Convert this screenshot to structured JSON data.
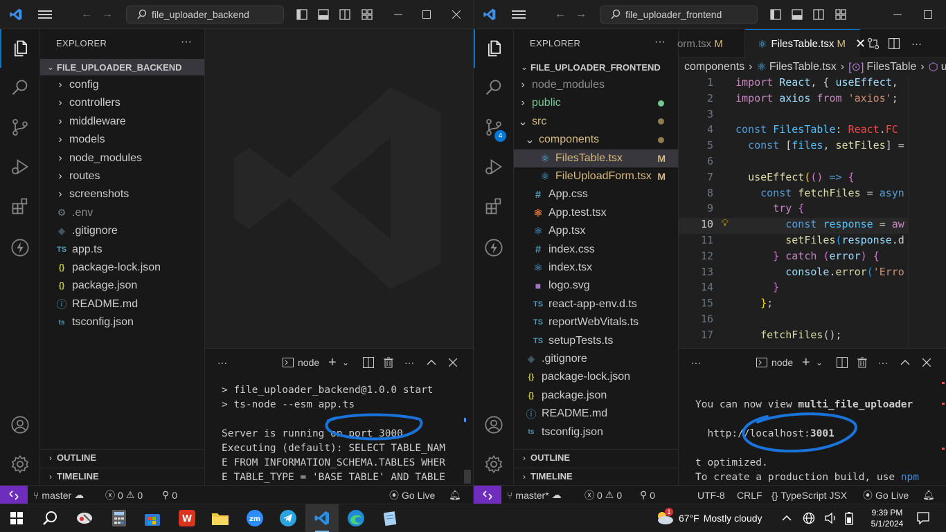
{
  "left": {
    "search": "file_uploader_backend",
    "explorer_title": "EXPLORER",
    "root_folder": "FILE_UPLOADER_BACKEND",
    "tree": [
      {
        "type": "folder",
        "label": "config"
      },
      {
        "type": "folder",
        "label": "controllers"
      },
      {
        "type": "folder",
        "label": "middleware"
      },
      {
        "type": "folder",
        "label": "models"
      },
      {
        "type": "folder",
        "label": "node_modules"
      },
      {
        "type": "folder",
        "label": "routes"
      },
      {
        "type": "folder",
        "label": "screenshots"
      },
      {
        "type": "env",
        "label": ".env"
      },
      {
        "type": "git",
        "label": ".gitignore"
      },
      {
        "type": "ts",
        "label": "app.ts",
        "icon_text": "TS"
      },
      {
        "type": "json",
        "label": "package-lock.json",
        "icon_text": "{}"
      },
      {
        "type": "json",
        "label": "package.json",
        "icon_text": "{}"
      },
      {
        "type": "info",
        "label": "README.md"
      },
      {
        "type": "tsconfig",
        "label": "tsconfig.json"
      }
    ],
    "outline": "OUTLINE",
    "timeline": "TIMELINE",
    "panel_tab": "node",
    "terminal": [
      "> file_uploader_backend@1.0.0 start",
      "> ts-node --esm app.ts",
      "",
      "Server is running on port 3000",
      "Executing (default): SELECT TABLE_NAM",
      "E FROM INFORMATION_SCHEMA.TABLES WHER",
      "E TABLE_TYPE = 'BASE TABLE' AND TABLE"
    ],
    "status": {
      "branch": "master",
      "errors": "0",
      "warnings": "0",
      "ports": "0",
      "golive": "Go Live"
    }
  },
  "right": {
    "search": "file_uploader_frontend",
    "explorer_title": "EXPLORER",
    "root_folder": "FILE_UPLOADER_FRONTEND",
    "scm_badge": "4",
    "tree": [
      {
        "type": "folder",
        "label": "node_modules",
        "indent": 1,
        "color": "#8b8b8b"
      },
      {
        "type": "folder",
        "label": "public",
        "indent": 1,
        "color": "#73c991",
        "dot": "#73c991"
      },
      {
        "type": "folder-open",
        "label": "src",
        "indent": 1,
        "color": "#d7ba7d",
        "dot": "#8e7d4f"
      },
      {
        "type": "folder-open",
        "label": "components",
        "indent": 2,
        "color": "#d7ba7d",
        "dot": "#8e7d4f"
      },
      {
        "type": "react",
        "label": "FilesTable.tsx",
        "indent": 3,
        "color": "#d7ba7d",
        "status": "M",
        "selected": true
      },
      {
        "type": "react",
        "label": "FileUploadForm.tsx",
        "indent": 3,
        "color": "#d7ba7d",
        "status": "M"
      },
      {
        "type": "css",
        "label": "App.css",
        "indent": 2,
        "icon_text": "#"
      },
      {
        "type": "test",
        "label": "App.test.tsx",
        "indent": 2
      },
      {
        "type": "react",
        "label": "App.tsx",
        "indent": 2
      },
      {
        "type": "css",
        "label": "index.css",
        "indent": 2,
        "icon_text": "#"
      },
      {
        "type": "react",
        "label": "index.tsx",
        "indent": 2
      },
      {
        "type": "svg",
        "label": "logo.svg",
        "indent": 2
      },
      {
        "type": "ts",
        "label": "react-app-env.d.ts",
        "indent": 2,
        "icon_text": "TS"
      },
      {
        "type": "ts",
        "label": "reportWebVitals.ts",
        "indent": 2,
        "icon_text": "TS"
      },
      {
        "type": "ts",
        "label": "setupTests.ts",
        "indent": 2,
        "icon_text": "TS"
      },
      {
        "type": "git",
        "label": ".gitignore",
        "indent": 1
      },
      {
        "type": "json",
        "label": "package-lock.json",
        "indent": 1,
        "icon_text": "{}"
      },
      {
        "type": "json",
        "label": "package.json",
        "indent": 1,
        "icon_text": "{}"
      },
      {
        "type": "info",
        "label": "README.md",
        "indent": 1
      },
      {
        "type": "tsconfig",
        "label": "tsconfig.json",
        "indent": 1
      }
    ],
    "outline": "OUTLINE",
    "timeline": "TIMELINE",
    "tabs": [
      {
        "label": "orm.tsx",
        "status": "M"
      },
      {
        "label": "FilesTable.tsx",
        "status": "M",
        "active": true
      }
    ],
    "breadcrumb": [
      "components",
      "FilesTable.tsx",
      "FilesTable",
      "u"
    ],
    "code": [
      {
        "n": "1",
        "tokens": [
          [
            "import ",
            "#c586c0"
          ],
          [
            "React",
            "#9cdcfe"
          ],
          [
            ", { ",
            "#cccccc"
          ],
          [
            "useEffect",
            "#9cdcfe"
          ],
          [
            ", ",
            "#cccccc"
          ]
        ]
      },
      {
        "n": "2",
        "tokens": [
          [
            "import ",
            "#c586c0"
          ],
          [
            "axios ",
            "#9cdcfe"
          ],
          [
            "from ",
            "#c586c0"
          ],
          [
            "'axios'",
            "#ce9178"
          ],
          [
            ";",
            "#cccccc"
          ]
        ]
      },
      {
        "n": "3",
        "tokens": []
      },
      {
        "n": "4",
        "tokens": [
          [
            "const ",
            "#569cd6"
          ],
          [
            "FilesTable",
            "#4fc1ff"
          ],
          [
            ": ",
            "#cccccc"
          ],
          [
            "React",
            "#f44747"
          ],
          [
            ".",
            "#cccccc"
          ],
          [
            "FC",
            "#f44747"
          ]
        ]
      },
      {
        "n": "5",
        "tokens": [
          [
            "  const ",
            "#569cd6"
          ],
          [
            "[",
            "#cccccc"
          ],
          [
            "files",
            "#4fc1ff"
          ],
          [
            ", ",
            "#cccccc"
          ],
          [
            "setFiles",
            "#dcdcaa"
          ],
          [
            "] =",
            "#cccccc"
          ]
        ]
      },
      {
        "n": "6",
        "tokens": []
      },
      {
        "n": "7",
        "tokens": [
          [
            "  ",
            "#cccccc"
          ],
          [
            "useEffect",
            "#dcdcaa"
          ],
          [
            "(",
            "#ffd700"
          ],
          [
            "() ",
            "#da70d6"
          ],
          [
            "=> ",
            "#569cd6"
          ],
          [
            "{",
            "#da70d6"
          ]
        ]
      },
      {
        "n": "8",
        "tokens": [
          [
            "    const ",
            "#569cd6"
          ],
          [
            "fetchFiles",
            "#dcdcaa"
          ],
          [
            " = ",
            "#cccccc"
          ],
          [
            "asyn",
            "#569cd6"
          ]
        ]
      },
      {
        "n": "9",
        "tokens": [
          [
            "      ",
            "#cccccc"
          ],
          [
            "try ",
            "#c586c0"
          ],
          [
            "{",
            "#da70d6"
          ]
        ]
      },
      {
        "n": "10",
        "tokens": [
          [
            "        const ",
            "#569cd6"
          ],
          [
            "response",
            "#4fc1ff"
          ],
          [
            " = ",
            "#cccccc"
          ],
          [
            "aw",
            "#c586c0"
          ]
        ],
        "current": true
      },
      {
        "n": "11",
        "tokens": [
          [
            "        ",
            "#cccccc"
          ],
          [
            "setFiles",
            "#dcdcaa"
          ],
          [
            "(",
            "#179fff"
          ],
          [
            "response",
            "#9cdcfe"
          ],
          [
            ".d",
            "#cccccc"
          ]
        ]
      },
      {
        "n": "12",
        "tokens": [
          [
            "      } ",
            "#da70d6"
          ],
          [
            "catch ",
            "#c586c0"
          ],
          [
            "(",
            "#da70d6"
          ],
          [
            "error",
            "#9cdcfe"
          ],
          [
            ") ",
            "#da70d6"
          ],
          [
            "{",
            "#da70d6"
          ]
        ]
      },
      {
        "n": "13",
        "tokens": [
          [
            "        ",
            "#cccccc"
          ],
          [
            "console",
            "#9cdcfe"
          ],
          [
            ".",
            "#cccccc"
          ],
          [
            "error",
            "#dcdcaa"
          ],
          [
            "(",
            "#179fff"
          ],
          [
            "'Erro",
            "#ce9178"
          ]
        ]
      },
      {
        "n": "14",
        "tokens": [
          [
            "      }",
            "#da70d6"
          ]
        ]
      },
      {
        "n": "15",
        "tokens": [
          [
            "    }",
            "#ffd700"
          ],
          [
            ";",
            "#cccccc"
          ]
        ]
      },
      {
        "n": "16",
        "tokens": []
      },
      {
        "n": "17",
        "tokens": [
          [
            "    ",
            "#cccccc"
          ],
          [
            "fetchFiles",
            "#dcdcaa"
          ],
          [
            "();",
            "#cccccc"
          ]
        ]
      }
    ],
    "panel_tab": "node",
    "terminal": {
      "line1_prefix": "You can now view ",
      "line1_app": "multi_file_uploader",
      "line2_prefix": "  http://localhost:",
      "line2_port": "3001",
      "line3": "t optimized.",
      "line4_prefix": "To create a production build, use ",
      "line4_cmd": "npm"
    },
    "status": {
      "branch": "master*",
      "errors": "0",
      "warnings": "0",
      "ports": "0",
      "encoding": "UTF-8",
      "eol": "CRLF",
      "language": "TypeScript JSX",
      "golive": "Go Live"
    }
  },
  "taskbar": {
    "weather_temp": "67°F",
    "weather_desc": "Mostly cloudy",
    "weather_badge": "1",
    "time": "9:39 PM",
    "date": "5/1/2024"
  },
  "colors": {
    "accent": "#0078d4",
    "remote": "#6f2dbd",
    "annotation": "#1a73d9",
    "modified": "#d7ba7d",
    "untracked": "#73c991"
  }
}
